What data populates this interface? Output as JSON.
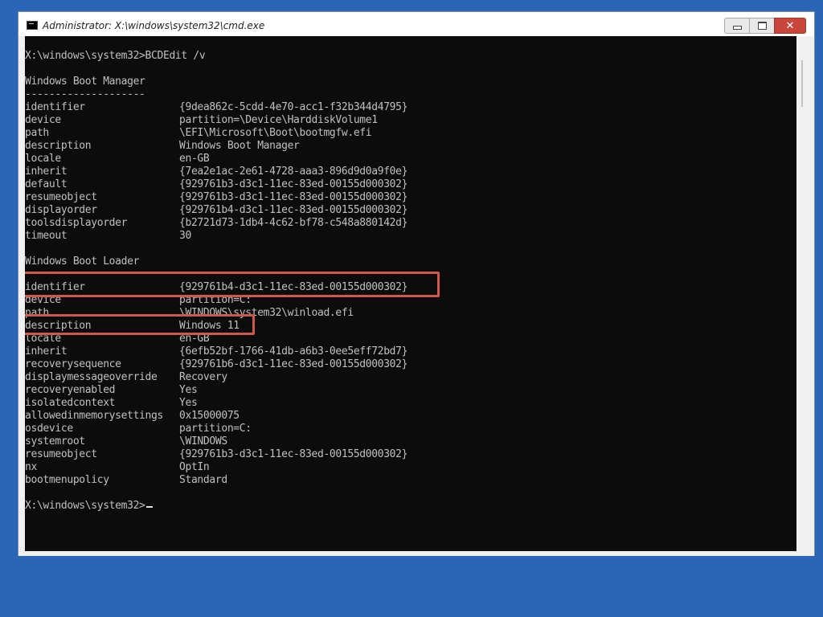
{
  "window": {
    "title": "Administrator: X:\\windows\\system32\\cmd.exe",
    "buttons": {
      "minimize_icon": "minimize-icon",
      "maximize_icon": "maximize-icon",
      "close_icon": "close-icon",
      "close_glyph": "✕"
    },
    "colors": {
      "desktop": "#2a66b5",
      "console_bg": "#0c0c0c",
      "console_text": "#c0c0c0",
      "highlight": "#d2574b",
      "close_button": "#c9463d"
    }
  },
  "console": {
    "command_line": "X:\\windows\\system32>BCDEdit /v",
    "boot_manager": {
      "heading": "Windows Boot Manager",
      "separator": "--------------------",
      "entries": [
        {
          "key": "identifier",
          "value": "{9dea862c-5cdd-4e70-acc1-f32b344d4795}"
        },
        {
          "key": "device",
          "value": "partition=\\Device\\HarddiskVolume1"
        },
        {
          "key": "path",
          "value": "\\EFI\\Microsoft\\Boot\\bootmgfw.efi"
        },
        {
          "key": "description",
          "value": "Windows Boot Manager"
        },
        {
          "key": "locale",
          "value": "en-GB"
        },
        {
          "key": "inherit",
          "value": "{7ea2e1ac-2e61-4728-aaa3-896d9d0a9f0e}"
        },
        {
          "key": "default",
          "value": "{929761b3-d3c1-11ec-83ed-00155d000302}"
        },
        {
          "key": "resumeobject",
          "value": "{929761b3-d3c1-11ec-83ed-00155d000302}"
        },
        {
          "key": "displayorder",
          "value": "{929761b4-d3c1-11ec-83ed-00155d000302}"
        },
        {
          "key": "toolsdisplayorder",
          "value": "{b2721d73-1db4-4c62-bf78-c548a880142d}"
        },
        {
          "key": "timeout",
          "value": "30"
        }
      ]
    },
    "boot_loader": {
      "heading": "Windows Boot Loader",
      "entries": [
        {
          "key": "identifier",
          "value": "{929761b4-d3c1-11ec-83ed-00155d000302}"
        },
        {
          "key": "device",
          "value": "partition=C:"
        },
        {
          "key": "path",
          "value": "\\WINDOWS\\system32\\winload.efi"
        },
        {
          "key": "description",
          "value": "Windows 11"
        },
        {
          "key": "locale",
          "value": "en-GB"
        },
        {
          "key": "inherit",
          "value": "{6efb52bf-1766-41db-a6b3-0ee5eff72bd7}"
        },
        {
          "key": "recoverysequence",
          "value": "{929761b6-d3c1-11ec-83ed-00155d000302}"
        },
        {
          "key": "displaymessageoverride",
          "value": "Recovery"
        },
        {
          "key": "recoveryenabled",
          "value": "Yes"
        },
        {
          "key": "isolatedcontext",
          "value": "Yes"
        },
        {
          "key": "allowedinmemorysettings",
          "value": "0x15000075"
        },
        {
          "key": "osdevice",
          "value": "partition=C:"
        },
        {
          "key": "systemroot",
          "value": "\\WINDOWS"
        },
        {
          "key": "resumeobject",
          "value": "{929761b3-d3c1-11ec-83ed-00155d000302}"
        },
        {
          "key": "nx",
          "value": "OptIn"
        },
        {
          "key": "bootmenupolicy",
          "value": "Standard"
        }
      ]
    },
    "prompt": "X:\\windows\\system32>"
  }
}
